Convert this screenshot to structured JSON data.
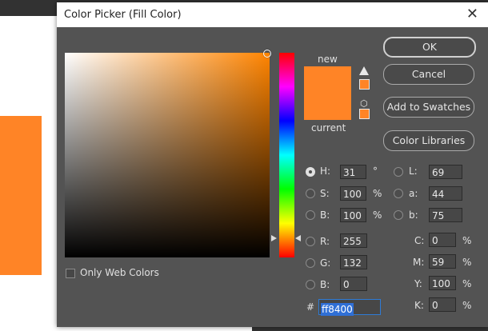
{
  "dialog": {
    "title": "Color Picker (Fill Color)",
    "close_glyph": "✕"
  },
  "preview": {
    "new_label": "new",
    "current_label": "current",
    "color": "#ff8426"
  },
  "buttons": {
    "ok": "OK",
    "cancel": "Cancel",
    "add_swatches": "Add to Swatches",
    "color_libraries": "Color Libraries"
  },
  "only_web_colors": "Only Web Colors",
  "fields": {
    "H": {
      "label": "H:",
      "value": "31",
      "unit": "°"
    },
    "S": {
      "label": "S:",
      "value": "100",
      "unit": "%"
    },
    "Bv": {
      "label": "B:",
      "value": "100",
      "unit": "%"
    },
    "R": {
      "label": "R:",
      "value": "255"
    },
    "G": {
      "label": "G:",
      "value": "132"
    },
    "Bc": {
      "label": "B:",
      "value": "0"
    },
    "L": {
      "label": "L:",
      "value": "69"
    },
    "a": {
      "label": "a:",
      "value": "44"
    },
    "b": {
      "label": "b:",
      "value": "75"
    },
    "C": {
      "label": "C:",
      "value": "0",
      "unit": "%"
    },
    "M": {
      "label": "M:",
      "value": "59",
      "unit": "%"
    },
    "Y": {
      "label": "Y:",
      "value": "100",
      "unit": "%"
    },
    "K": {
      "label": "K:",
      "value": "0",
      "unit": "%"
    }
  },
  "hex": {
    "label": "#",
    "value": "ff8400"
  },
  "icons": {
    "gamut_warning": "warning-triangle-icon",
    "web_safe": "cube-icon"
  }
}
